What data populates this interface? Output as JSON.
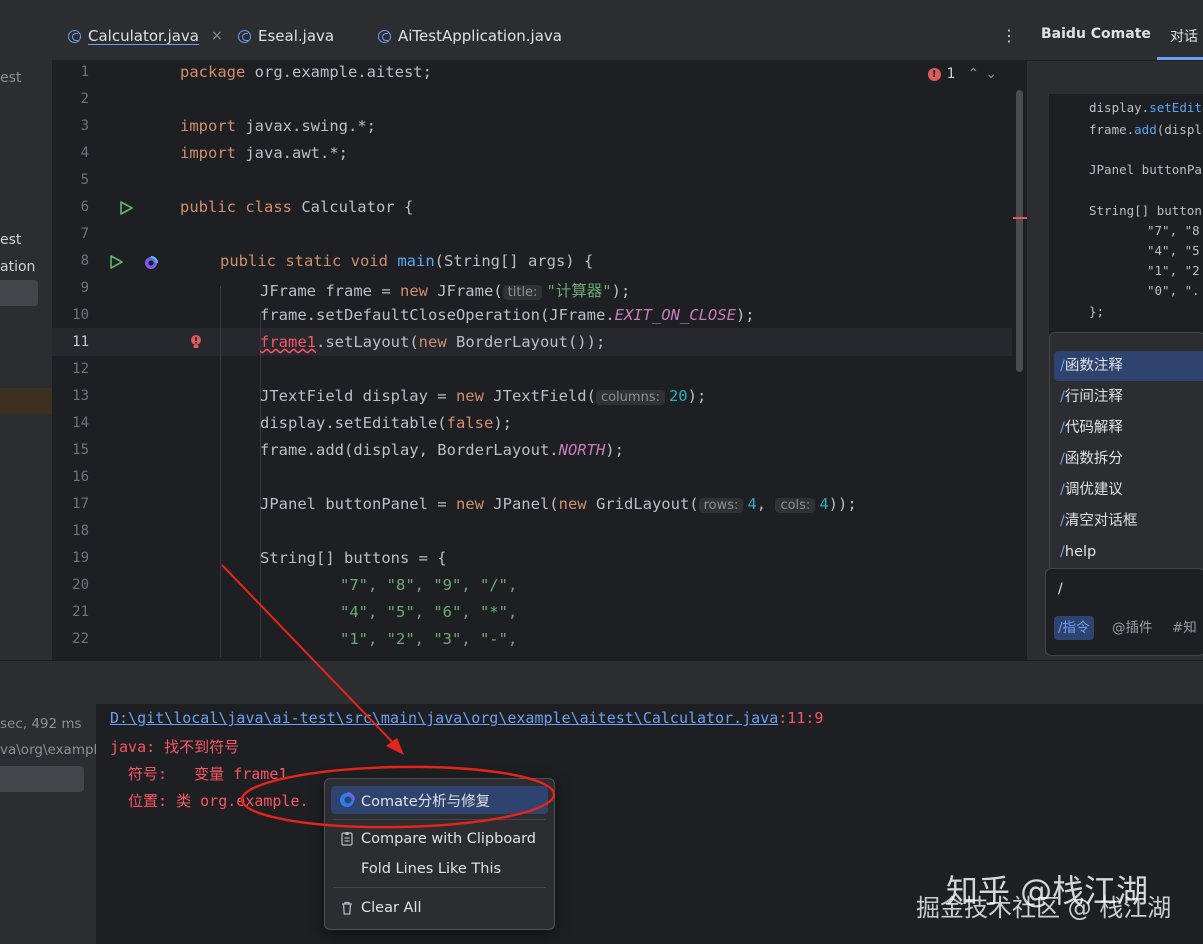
{
  "project_panel": {
    "items": [
      "est",
      "est",
      "ation"
    ]
  },
  "tabs": [
    {
      "label": "Calculator.java",
      "active": true
    },
    {
      "label": "Eseal.java",
      "active": false
    },
    {
      "label": "AiTestApplication.java",
      "active": false
    }
  ],
  "tab_close": "×",
  "more_menu": "⋮",
  "error_count": "1",
  "editor": {
    "current_line": 11,
    "line_numbers": [
      "1",
      "2",
      "3",
      "4",
      "5",
      "6",
      "7",
      "8",
      "9",
      "10",
      "11",
      "12",
      "13",
      "14",
      "15",
      "16",
      "17",
      "18",
      "19",
      "20",
      "21",
      "22"
    ],
    "hints": {
      "title": "title:",
      "columns": "columns:",
      "rows": "rows:",
      "cols": "cols:"
    },
    "code": {
      "l1_kw": "package",
      "l1_rest": " org.example.aitest;",
      "l3_kw": "import",
      "l3_rest": " javax.swing.*;",
      "l4_kw": "import",
      "l4_rest": " java.awt.*;",
      "l6_kw": "public class",
      "l6_rest": " Calculator {",
      "l8_kw": "public static void",
      "l8_fn": "main",
      "l8_rest": "(String[] args) {",
      "l9_a": "JFrame frame = ",
      "l9_kw": "new",
      "l9_b": " JFrame(",
      "l9_str": "\"计算器\"",
      "l9_c": ");",
      "l10_a": "frame.setDefaultCloseOperation(JFrame.",
      "l10_const": "EXIT_ON_CLOSE",
      "l10_c": ");",
      "l11_err": "frame1",
      "l11_a": ".setLayout(",
      "l11_kw": "new",
      "l11_b": " BorderLayout());",
      "l13_a": "JTextField display = ",
      "l13_kw": "new",
      "l13_b": " JTextField(",
      "l13_num": "20",
      "l13_c": ");",
      "l14_a": "display.setEditable(",
      "l14_kw": "false",
      "l14_c": ");",
      "l15_a": "frame.add(display, BorderLayout.",
      "l15_const": "NORTH",
      "l15_c": ");",
      "l17_a": "JPanel buttonPanel = ",
      "l17_kw": "new",
      "l17_b": " JPanel(",
      "l17_kw2": "new",
      "l17_c": " GridLayout(",
      "l17_num1": "4",
      "l17_d": ", ",
      "l17_num2": "4",
      "l17_e": "));",
      "l19_a": "String[] buttons = {",
      "l20": "\"7\", \"8\", \"9\", \"/\",",
      "l21": "\"4\", \"5\", \"6\", \"*\",",
      "l22": "\"1\", \"2\", \"3\", \"-\","
    }
  },
  "right_panel": {
    "title": "Baidu Comate",
    "tab": "对话",
    "code_lines": [
      {
        "a": "display.",
        "fn": "setEdita",
        "b": ""
      },
      {
        "a": "frame.",
        "fn": "add",
        "b": "(displa"
      },
      {
        "a": "JPanel buttonPar",
        "fn": "",
        "b": ""
      },
      {
        "a": "String[] buttons",
        "fn": "",
        "b": ""
      },
      {
        "a": "\"7\", \"8",
        "fn": "",
        "b": ""
      },
      {
        "a": "\"4\", \"5",
        "fn": "",
        "b": ""
      },
      {
        "a": "\"1\", \"2",
        "fn": "",
        "b": ""
      },
      {
        "a": "\"0\", \".",
        "fn": "",
        "b": ""
      },
      {
        "a": "};",
        "fn": "",
        "b": ""
      }
    ],
    "commands": [
      {
        "slash": "/",
        "label": "函数注释",
        "selected": true
      },
      {
        "slash": "/",
        "label": "行间注释",
        "selected": false
      },
      {
        "slash": "/",
        "label": "代码解释",
        "selected": false
      },
      {
        "slash": "/",
        "label": "函数拆分",
        "selected": false
      },
      {
        "slash": "/",
        "label": "调优建议",
        "selected": false
      },
      {
        "slash": "/",
        "label": "清空对话框",
        "selected": false
      },
      {
        "slash": "/",
        "label": "help",
        "selected": false
      }
    ],
    "input_value": "/",
    "chips": [
      "/指令",
      "@插件",
      "#知"
    ]
  },
  "bottom_left": {
    "time": "sec, 492 ms",
    "path": "va\\org\\example"
  },
  "console": {
    "path_link": "D:\\git\\local\\java\\ai-test\\src\\main\\java\\org\\example\\aitest\\Calculator.java",
    "path_pos": ":11:9",
    "line2": "java: 找不到符号",
    "line3": "  符号:   变量 frame1",
    "line4": "  位置: 类 org.example."
  },
  "context_menu": {
    "items": [
      {
        "label": "Comate分析与修复",
        "icon": "comate-icon",
        "selected": true
      },
      {
        "label": "Compare with Clipboard",
        "icon": "clipboard-compare-icon",
        "selected": false
      },
      {
        "label": "Fold Lines Like This",
        "icon": "",
        "selected": false
      },
      {
        "label": "Clear All",
        "icon": "trash-icon",
        "selected": false
      }
    ]
  },
  "watermark": {
    "line1": "知乎 @栈江湖",
    "line2": "掘金技术社区 @ 栈江湖"
  },
  "colors": {
    "background": "#1e1f22",
    "panel": "#2b2d30",
    "accent": "#6b9ff2",
    "error": "#f75464",
    "annotation": "#e5251b"
  }
}
